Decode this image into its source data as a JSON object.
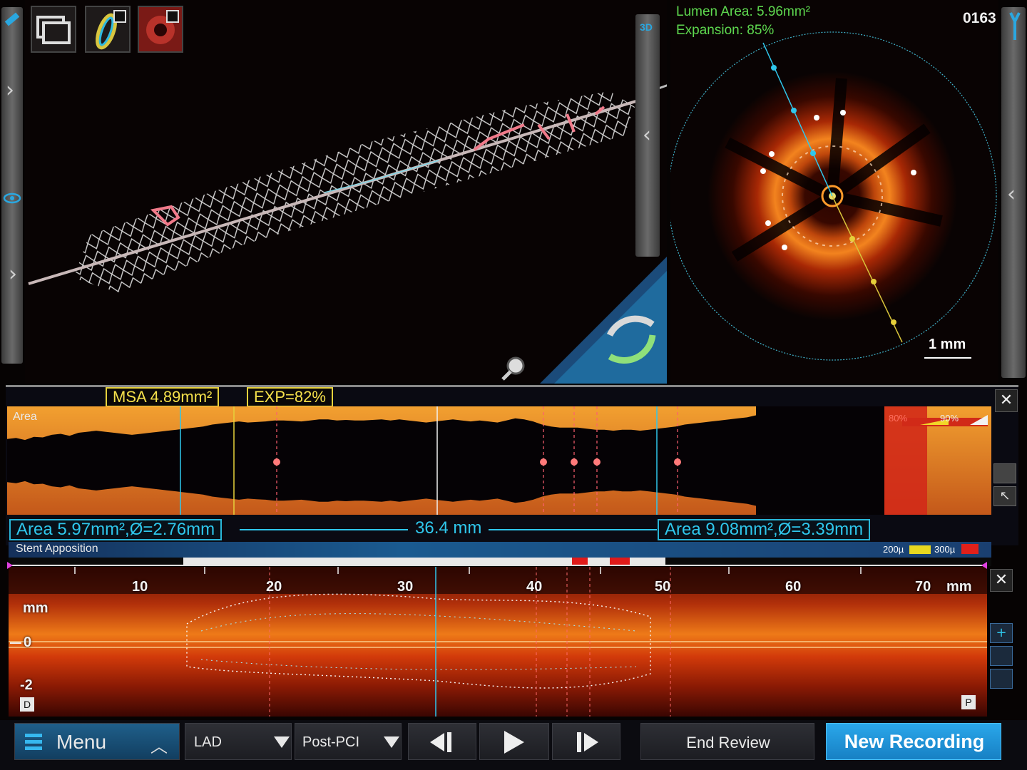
{
  "header": {
    "frame_number": "0163",
    "lumen_area": "Lumen Area: 5.96mm²",
    "expansion": "Expansion: 85%",
    "view_3d_label": "3D",
    "scale_bar_label": "1 mm"
  },
  "thumbnails": [
    {
      "icon": "layers-icon"
    },
    {
      "icon": "stent-ring-icon"
    },
    {
      "icon": "vessel-crosssection-icon"
    }
  ],
  "area_strip": {
    "title": "Area",
    "msa": "MSA 4.89mm²",
    "exp": "EXP=82%",
    "legend_80": "80%",
    "legend_90": "90%",
    "proximal_ref": "Area 5.97mm²,Ø=2.76mm",
    "distance": "36.4 mm",
    "distal_ref": "Area 9.08mm²,Ø=3.39mm",
    "lumen_profile_pct": [
      58,
      56,
      60,
      54,
      55,
      50,
      48,
      52,
      46,
      44,
      42,
      44,
      46,
      48,
      50,
      48,
      46,
      44,
      42,
      40,
      38,
      36,
      34,
      30,
      28,
      26,
      24,
      26,
      25,
      24,
      22,
      22,
      23,
      24,
      22,
      20,
      20,
      22,
      21,
      22,
      22,
      21,
      20,
      22,
      20,
      22,
      24,
      26,
      24,
      22,
      20,
      22,
      24,
      22,
      24,
      26,
      22,
      18,
      20,
      24,
      30,
      34,
      36,
      36,
      36,
      38,
      40,
      40,
      42,
      40,
      40,
      42,
      40,
      38,
      36,
      34,
      30,
      28,
      26,
      24,
      22,
      20,
      18,
      16,
      12
    ]
  },
  "apposition": {
    "title": "Stent Apposition",
    "legend_200": "200µ",
    "legend_300": "300µ"
  },
  "longitudinal": {
    "unit": "mm",
    "ticks": [
      "10",
      "20",
      "30",
      "40",
      "50",
      "60",
      "70"
    ],
    "mm_label": "mm",
    "zero_label": "0",
    "neg2_label": "-2",
    "d_marker": "D",
    "p_marker": "P"
  },
  "toolbar": {
    "menu_label": "Menu",
    "vessel": "LAD",
    "phase": "Post-PCI",
    "end_review": "End Review",
    "new_recording": "New Recording"
  },
  "colors": {
    "accent_cyan": "#2fc7ec",
    "accent_yellow": "#f4e04b",
    "accent_green": "#5ed84f",
    "new_recording_bg": "#1c8fd6"
  }
}
